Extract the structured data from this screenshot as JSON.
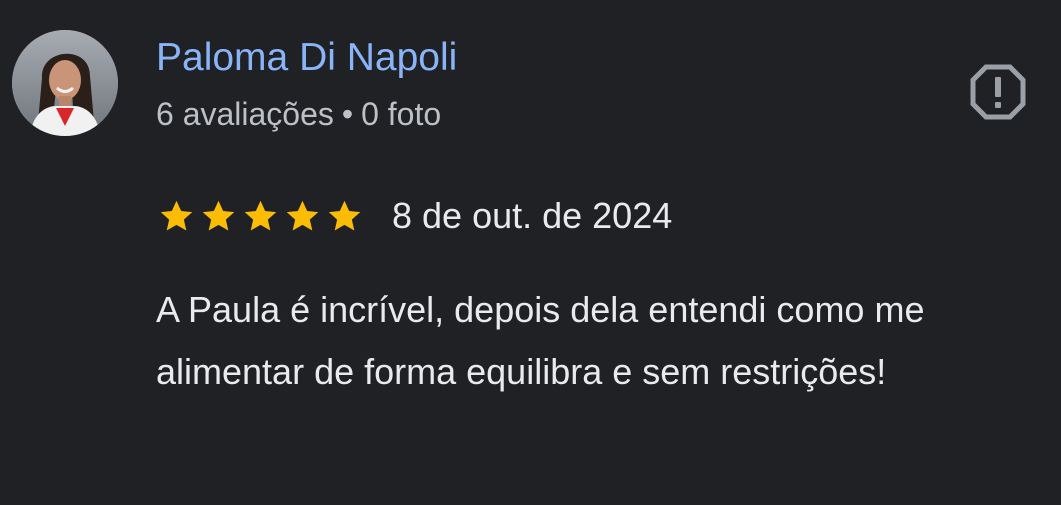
{
  "reviewer": {
    "name": "Paloma Di Napoli",
    "review_count": "6 avaliações",
    "separator": "•",
    "photo_count": "0 foto",
    "avatar_icon": "profile-photo"
  },
  "actions": {
    "report_icon": "report-icon"
  },
  "review": {
    "rating": 5,
    "rating_max": 5,
    "star_color": "#fbbc04",
    "date": "8 de out. de 2024",
    "text": "A Paula é incrível, depois dela entendi como me alimentar de forma equilibra e sem restrições!"
  },
  "colors": {
    "background": "#202124",
    "name": "#8ab4f8",
    "meta": "#bdc1c6",
    "text": "#e8eaed",
    "icon": "#9aa0a6"
  }
}
